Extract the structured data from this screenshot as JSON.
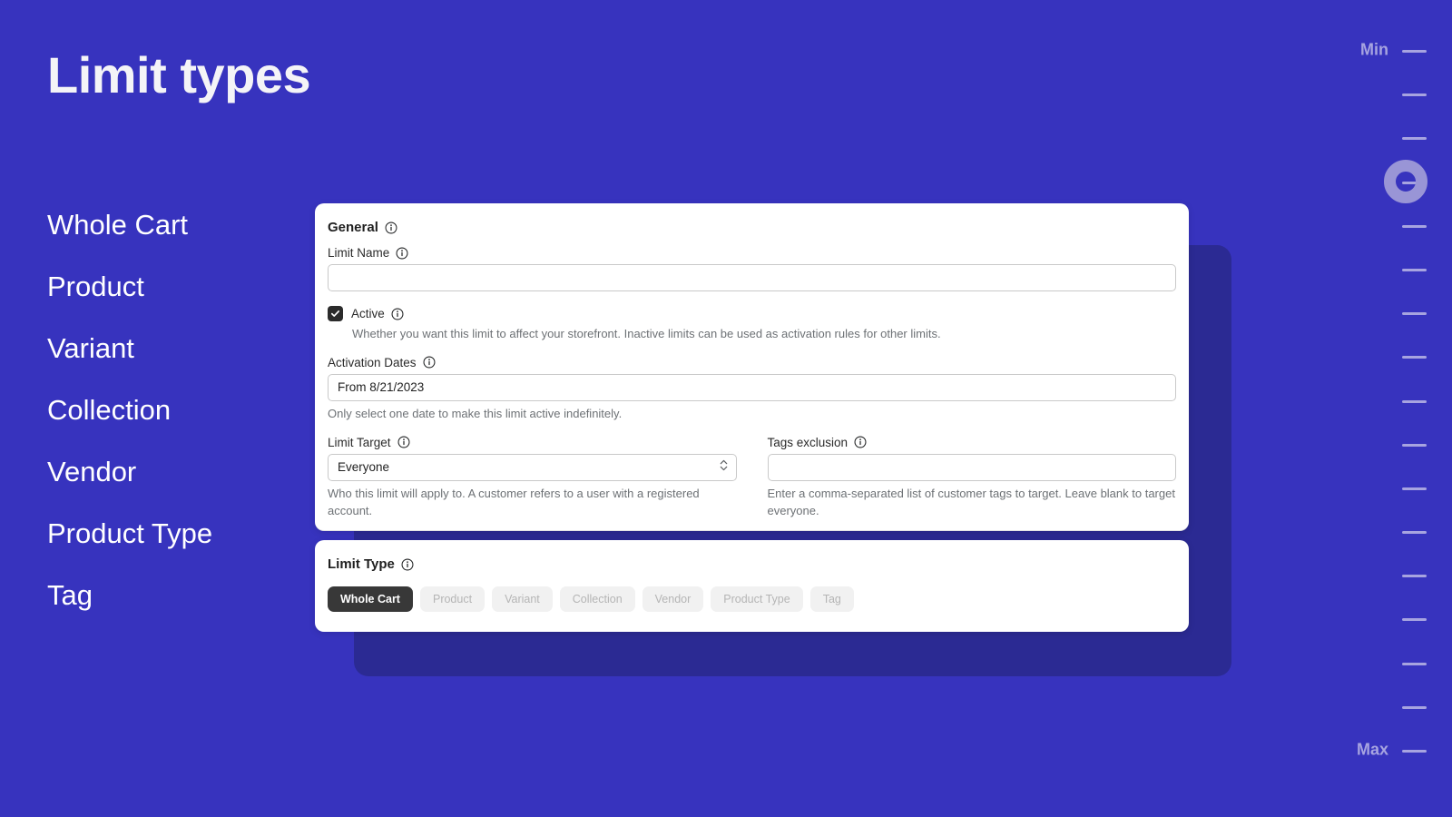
{
  "theme": {
    "background": "#3733be",
    "back_panel": "#2b2a93",
    "card": "#ffffff",
    "accent_dark": "#383838",
    "slider_accent": "#a7a4e0"
  },
  "page": {
    "title": "Limit types"
  },
  "nav": {
    "items": [
      {
        "label": "Whole Cart"
      },
      {
        "label": "Product"
      },
      {
        "label": "Variant"
      },
      {
        "label": "Collection"
      },
      {
        "label": "Vendor"
      },
      {
        "label": "Product Type"
      },
      {
        "label": "Tag"
      }
    ]
  },
  "general": {
    "title": "General",
    "info_icon": "info-icon",
    "limit_name": {
      "label": "Limit Name",
      "value": "",
      "placeholder": ""
    },
    "active": {
      "label": "Active",
      "checked": true,
      "help": "Whether you want this limit to affect your storefront. Inactive limits can be used as activation rules for other limits."
    },
    "activation_dates": {
      "label": "Activation Dates",
      "value": "From 8/21/2023",
      "placeholder": "",
      "help": "Only select one date to make this limit active indefinitely."
    },
    "limit_target": {
      "label": "Limit Target",
      "value": "Everyone",
      "options": [
        "Everyone"
      ],
      "help": "Who this limit will apply to. A customer refers to a user with a registered account."
    },
    "tags_exclusion": {
      "label": "Tags exclusion",
      "value": "",
      "placeholder": "",
      "help": "Enter a comma-separated list of customer tags to target. Leave blank to target everyone."
    }
  },
  "limit_type": {
    "title": "Limit Type",
    "selected": "Whole Cart",
    "chips": [
      {
        "label": "Whole Cart",
        "active": true
      },
      {
        "label": "Product",
        "active": false
      },
      {
        "label": "Variant",
        "active": false
      },
      {
        "label": "Collection",
        "active": false
      },
      {
        "label": "Vendor",
        "active": false
      },
      {
        "label": "Product Type",
        "active": false
      },
      {
        "label": "Tag",
        "active": false
      }
    ]
  },
  "slider": {
    "min_label": "Min",
    "max_label": "Max",
    "tick_count": 17,
    "handle_index": 3
  }
}
